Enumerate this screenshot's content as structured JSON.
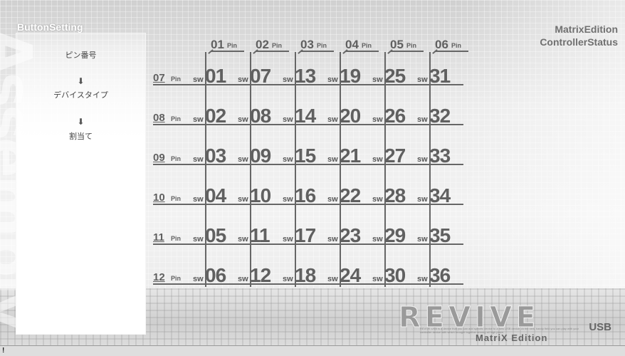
{
  "window": {
    "watermark": "AssemblyDesk"
  },
  "panel": {
    "title": "ButtonSetting",
    "steps": [
      "ピン番号",
      "デバイスタイプ",
      "割当て"
    ],
    "arrow_glyph": "⬇"
  },
  "header": {
    "line1": "MatrixEdition",
    "line2": "ControllerStatus"
  },
  "matrix": {
    "pin_unit": "Pin",
    "sw_prefix": "sw",
    "columns": [
      "01",
      "02",
      "03",
      "04",
      "05",
      "06"
    ],
    "rows": [
      "07",
      "08",
      "09",
      "10",
      "11",
      "12"
    ],
    "switches": [
      [
        "01",
        "07",
        "13",
        "19",
        "25",
        "31"
      ],
      [
        "02",
        "08",
        "14",
        "20",
        "26",
        "32"
      ],
      [
        "03",
        "09",
        "15",
        "21",
        "27",
        "33"
      ],
      [
        "04",
        "10",
        "16",
        "22",
        "28",
        "34"
      ],
      [
        "05",
        "11",
        "17",
        "23",
        "29",
        "35"
      ],
      [
        "06",
        "12",
        "18",
        "24",
        "30",
        "36"
      ]
    ]
  },
  "logo": {
    "word": "REVIVE",
    "usb": "USB",
    "fine_print": "REVIVE USB is a device that you can add specific device to a new USB device. At the new, handy field you can play with your controller device with which brought together among all high place.",
    "sub": "MatriX Edition"
  },
  "statusbar": {
    "mark": "!"
  }
}
